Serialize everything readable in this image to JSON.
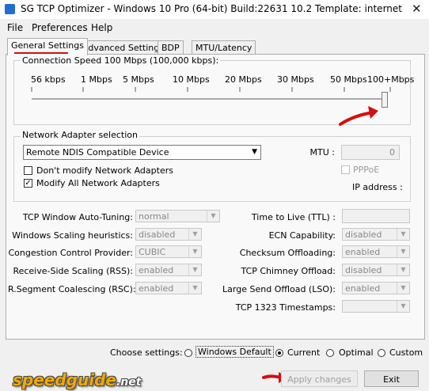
{
  "window": {
    "title": "SG TCP Optimizer - Windows 10 Pro (64-bit) Build:22631 10.2  Template: internet",
    "close_glyph": "✕"
  },
  "menu": [
    "File",
    "Preferences",
    "Help"
  ],
  "tabs": [
    "General Settings",
    "Advanced Settings",
    "BDP",
    "MTU/Latency"
  ],
  "connection_speed": {
    "label": "Connection Speed  100 Mbps (100,000 kbps):",
    "ticks": [
      "56 kbps",
      "1 Mbps",
      "5 Mbps",
      "10 Mbps",
      "20 Mbps",
      "30 Mbps",
      "50 Mbps",
      "100+Mbps"
    ],
    "slider_fraction": 1.0
  },
  "adapter": {
    "group_label": "Network Adapter selection",
    "selected": "Remote NDIS Compatible Device",
    "mtu_label": "MTU :",
    "mtu_value": "0",
    "dont_modify": "Don't modify Network Adapters",
    "modify_all": "Modify All Network Adapters",
    "pppoe": "PPPoE",
    "ip_label": "IP address :"
  },
  "left_settings": [
    {
      "label": "TCP Window Auto-Tuning:",
      "value": "normal"
    },
    {
      "label": "Windows Scaling heuristics:",
      "value": "disabled"
    },
    {
      "label": "Congestion Control Provider:",
      "value": "CUBIC"
    },
    {
      "label": "Receive-Side Scaling (RSS):",
      "value": "enabled"
    },
    {
      "label": "R.Segment Coalescing (RSC):",
      "value": "enabled"
    }
  ],
  "right_settings": [
    {
      "label": "Time to Live (TTL) :",
      "value": ""
    },
    {
      "label": "ECN Capability:",
      "value": "disabled"
    },
    {
      "label": "Checksum Offloading:",
      "value": "enabled"
    },
    {
      "label": "TCP Chimney Offload:",
      "value": "disabled"
    },
    {
      "label": "Large Send Offload (LSO):",
      "value": "enabled"
    },
    {
      "label": "TCP 1323 Timestamps:",
      "value": ""
    }
  ],
  "choose": {
    "label": "Choose settings:",
    "options": [
      "Windows Default",
      "Current",
      "Optimal",
      "Custom"
    ],
    "selected": "Current"
  },
  "buttons": {
    "apply": "Apply changes",
    "exit": "Exit"
  },
  "logo": {
    "text": "speedguide",
    "suffix": ".net"
  },
  "colors": {
    "annotation_red": "#d40f0f",
    "logo_gold": "#f2a900"
  }
}
